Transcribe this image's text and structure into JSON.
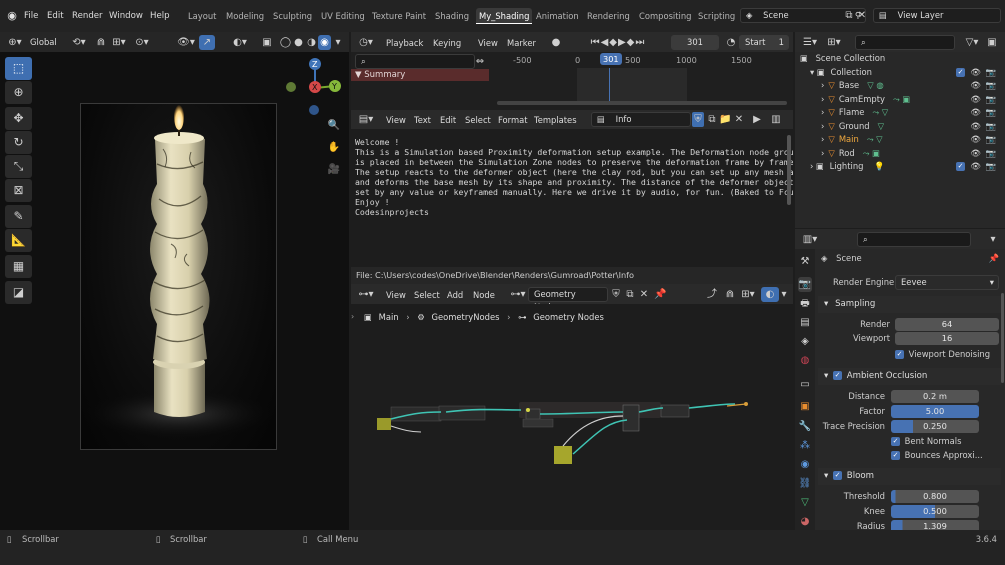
{
  "menu": [
    "File",
    "Edit",
    "Render",
    "Window",
    "Help"
  ],
  "workspaces": [
    {
      "label": "Layout",
      "active": false
    },
    {
      "label": "Modeling",
      "active": false
    },
    {
      "label": "Sculpting",
      "active": false
    },
    {
      "label": "UV Editing",
      "active": false
    },
    {
      "label": "Texture Paint",
      "active": false
    },
    {
      "label": "Shading",
      "active": false
    },
    {
      "label": "My_Shading",
      "active": true
    },
    {
      "label": "Animation",
      "active": false
    },
    {
      "label": "Rendering",
      "active": false
    },
    {
      "label": "Compositing",
      "active": false
    },
    {
      "label": "Scripting",
      "active": false
    }
  ],
  "scene_name": "Scene",
  "view_layer": "View Layer",
  "viewport": {
    "orientation": "Global"
  },
  "timeline": {
    "playback": "Playback",
    "keying": "Keying",
    "view": "View",
    "marker": "Marker",
    "current_frame": "301",
    "start_label": "Start",
    "start_value": "1",
    "ruler": [
      "-500",
      "0",
      "301",
      "500",
      "1000",
      "1500"
    ],
    "summary": "Summary"
  },
  "text_editor": {
    "menu": [
      "View",
      "Text",
      "Edit",
      "Select",
      "Format",
      "Templates"
    ],
    "file_name": "Info",
    "lines": [
      "Welcome !",
      "",
      "",
      "This is a Simulation based Proximity deformation setup example. The Deformation node group",
      "is placed in between the Simulation Zone nodes to preserve the deformation frame by frame.",
      "",
      "The setup reacts to the deformer object (here the clay rod, but you can set up any mesh as",
      "and deforms the base mesh by its shape and proximity. The distance of the deformer object ca",
      "set by any value or keyframed manually. Here we drive it by audio, for fun. (Baked to Fcurv",
      "",
      "Enjoy !",
      "",
      "Codesinprojects"
    ],
    "file_path": "File: C:\\Users\\codes\\OneDrive\\Blender\\Renders\\Gumroad\\Potter\\Info"
  },
  "node_editor": {
    "menu": [
      "View",
      "Select",
      "Add",
      "Node"
    ],
    "tree_type": "Geometry Nodes",
    "breadcrumb": [
      "Main",
      "GeometryNodes",
      "Geometry Nodes"
    ]
  },
  "outliner": {
    "root": "Scene Collection",
    "collection": "Collection",
    "items": [
      {
        "name": "Base",
        "highlight": false
      },
      {
        "name": "CamEmpty",
        "highlight": false
      },
      {
        "name": "Flame",
        "highlight": false
      },
      {
        "name": "Ground",
        "highlight": false
      },
      {
        "name": "Main",
        "highlight": true
      },
      {
        "name": "Rod",
        "highlight": false
      }
    ],
    "lighting": "Lighting"
  },
  "properties": {
    "scene_label": "Scene",
    "render_engine_label": "Render Engine",
    "render_engine": "Eevee",
    "sampling": {
      "title": "Sampling",
      "render_label": "Render",
      "render": "64",
      "viewport_label": "Viewport",
      "viewport": "16",
      "denoise": "Viewport Denoising"
    },
    "ao": {
      "title": "Ambient Occlusion",
      "distance_label": "Distance",
      "distance": "0.2 m",
      "factor_label": "Factor",
      "factor": "5.00",
      "trace_label": "Trace Precision",
      "trace": "0.250",
      "bent": "Bent Normals",
      "bounces": "Bounces Approxi..."
    },
    "bloom": {
      "title": "Bloom",
      "threshold_label": "Threshold",
      "threshold": "0.800",
      "knee_label": "Knee",
      "knee": "0.500",
      "radius_label": "Radius",
      "radius": "1.309"
    }
  },
  "status": {
    "left": "Scrollbar",
    "middle": "Scrollbar",
    "right": "Call Menu",
    "version": "3.6.4"
  }
}
